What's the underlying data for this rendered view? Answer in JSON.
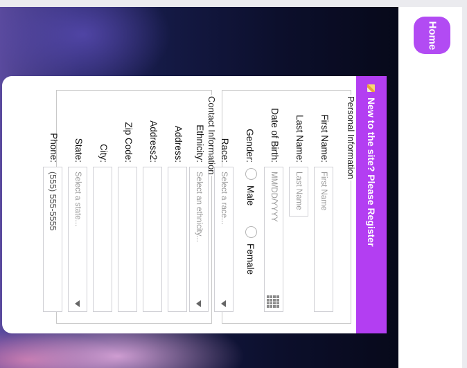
{
  "nav": {
    "home_label": "Home"
  },
  "form": {
    "title": "New to the site? Please Register",
    "personal": {
      "legend": "Personal Information",
      "first_name": {
        "label": "First Name:",
        "placeholder": "First Name"
      },
      "last_name": {
        "label": "Last Name:",
        "placeholder": "Last Name"
      },
      "dob": {
        "label": "Date of Birth:",
        "placeholder": "MM/DD/YYYY"
      },
      "gender": {
        "label": "Gender:",
        "options": [
          "Male",
          "Female"
        ]
      },
      "race": {
        "label": "Race:",
        "placeholder": "Select a race..."
      },
      "ethnicity": {
        "label": "Ethnicity:",
        "placeholder": "Select an ethnicity..."
      }
    },
    "contact": {
      "legend": "Contact Information",
      "address": {
        "label": "Address:"
      },
      "address2": {
        "label": "Address2:"
      },
      "zip": {
        "label": "Zip Code:"
      },
      "city": {
        "label": "City:"
      },
      "state": {
        "label": "State:",
        "placeholder": "Select a state..."
      },
      "phone": {
        "label": "Phone:",
        "placeholder": "(555) 555-5555"
      }
    }
  },
  "colors": {
    "accent": "#b33ef2",
    "home_button": "#b24bf3"
  }
}
